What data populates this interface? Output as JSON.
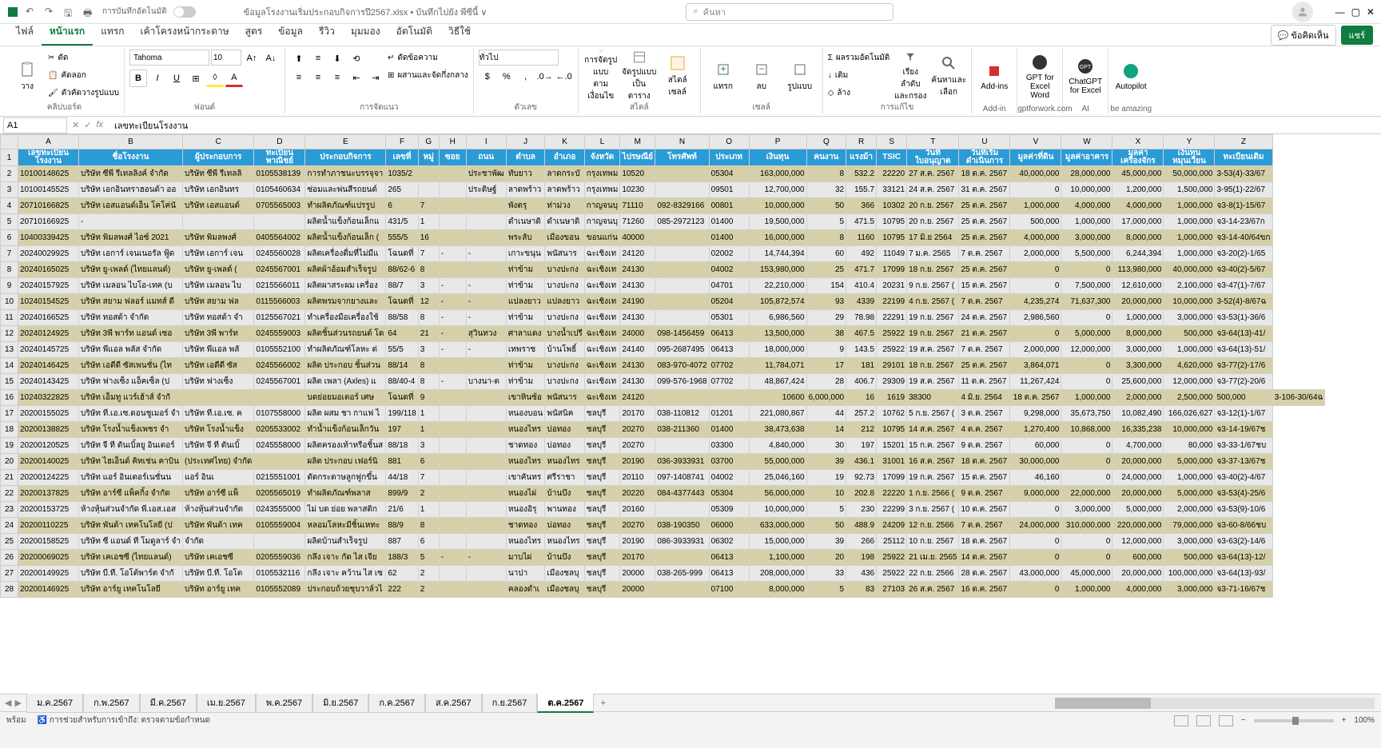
{
  "title": {
    "autosave_label": "การบันทึกอัตโนมัติ",
    "filename": "ข้อมูลโรงงานเริ่มประกอบกิจการปี2567.xlsx • บันทึกไปยัง พีซีนี้ ∨",
    "search_placeholder": "ค้นหา"
  },
  "tabs": [
    "ไฟล์",
    "หน้าแรก",
    "แทรก",
    "เค้าโครงหน้ากระดาษ",
    "สูตร",
    "ข้อมูล",
    "รีวิว",
    "มุมมอง",
    "อัตโนมัติ",
    "วิธีใช้"
  ],
  "active_tab": 1,
  "ribbon_right": {
    "comments": "ข้อคิดเห็น",
    "share": "แชร์"
  },
  "ribbon": {
    "clipboard": {
      "paste": "วาง",
      "cut": "ตัด",
      "copy": "คัดลอก",
      "fmtpaint": "ตัวคัดวางรูปแบบ",
      "group": "คลิปบอร์ด"
    },
    "font": {
      "name": "Tahoma",
      "size": "10",
      "group": "ฟอนต์"
    },
    "align": {
      "wrap": "ตัดข้อความ",
      "merge": "ผสานและจัดกึ่งกลาง",
      "group": "การจัดแนว"
    },
    "number": {
      "format": "ทั่วไป",
      "group": "ตัวเลข"
    },
    "styles": {
      "condfmt": "การจัดรูปแบบ\nตามเงื่อนไข",
      "table": "จัดรูปแบบ\nเป็นตาราง",
      "cellstyle": "สไตล์\nเซลล์",
      "group": "สไตล์"
    },
    "cells": {
      "insert": "แทรก",
      "delete": "ลบ",
      "format": "รูปแบบ",
      "group": "เซลล์"
    },
    "editing": {
      "sum": "ผลรวมอัตโนมัติ",
      "fill": "เติม",
      "clear": "ล้าง",
      "sort": "เรียงลำดับ\nและกรอง",
      "find": "ค้นหาและ\nเลือก",
      "group": "การแก้ไข"
    },
    "addins": {
      "addins": "Add-ins",
      "group": "Add-in"
    },
    "gpt": {
      "word": "GPT for\nExcel Word",
      "chat": "ChatGPT\nfor Excel",
      "auto": "Autopilot",
      "group1": "gptforwork.com",
      "group2": "AI",
      "group3": "be amazing"
    }
  },
  "formula": {
    "cell": "A1",
    "value": "เลขทะเบียนโรงงาน"
  },
  "cols": [
    "A",
    "B",
    "C",
    "D",
    "E",
    "F",
    "G",
    "H",
    "I",
    "J",
    "K",
    "L",
    "M",
    "N",
    "O",
    "P",
    "Q",
    "R",
    "S",
    "T",
    "U",
    "V",
    "W",
    "X",
    "Y",
    "Z"
  ],
  "headers": [
    "เลขทะเบียน\nโรงงาน",
    "ชื่อโรงงาน",
    "ผู้ประกอบการ",
    "ทะเบียน\nพาณิชย์",
    "ประกอบกิจการ",
    "เลขที่",
    "หมู่",
    "ซอย",
    "ถนน",
    "ตำบล",
    "อำเภอ",
    "จังหวัด",
    "ไปรษณีย์",
    "โทรศัพท์",
    "ประเภท",
    "เงินทุน",
    "คนงาน",
    "แรงม้า",
    "TSIC",
    "วันที่\nใบอนุญาต",
    "วันที่เริ่ม\nดำเนินการ",
    "มูลค่าที่ดิน",
    "มูลค่าอาคาร",
    "มูลค่า\nเครื่องจักร",
    "เงินทุน\nหมุนเวียน",
    "ทะเบียนเดิม"
  ],
  "rows": [
    [
      "10100148625",
      "บริษัท ซีพี รีเทลลิงค์ จำกัด",
      "บริษัท ซีพี รีเทลลิ",
      "0105538139",
      "การทำภาชนะบรรจุจา",
      "1035/2",
      "",
      "",
      "ประชาพัฒ",
      "ทับยาว",
      "ลาดกระบั",
      "กรุงเทพม",
      "10520",
      "",
      "05304",
      "163,000,000",
      "8",
      "532.2",
      "22220",
      "27 ส.ค. 2567",
      "18 ต.ค. 2567",
      "40,000,000",
      "28,000,000",
      "45,000,000",
      "50,000,000",
      "3-53(4)-33/67"
    ],
    [
      "10100145525",
      "บริษัท เอกอินทราฮอนด้า ออ",
      "บริษัท เอกอินทร",
      "0105460634",
      "ซ่อมและพ่นสีรถยนต์",
      "265",
      "",
      "",
      "ประดิษฐ์",
      "ลาดพร้าว",
      "ลาดพร้าว",
      "กรุงเทพม",
      "10230",
      "",
      "09501",
      "12,700,000",
      "32",
      "155.7",
      "33121",
      "24 ส.ค. 2567",
      "31 ต.ค. 2567",
      "0",
      "10,000,000",
      "1,200,000",
      "1,500,000",
      "3-95(1)-22/67"
    ],
    [
      "20710166825",
      "บริษัท เอสแอนด์เอ็น โคโค่นั",
      "บริษัท เอสแอนด์",
      "0705565003",
      "ทำผลิตภัณฑ์แปรรูป",
      "6",
      "7",
      "",
      "",
      "พังตรุ",
      "ท่าม่วง",
      "กาญจนบุ",
      "71110",
      "092-8329166",
      "00801",
      "10,000,000",
      "50",
      "366",
      "10302",
      "20 ก.ย. 2567",
      "25 ต.ค. 2567",
      "1,000,000",
      "4,000,000",
      "4,000,000",
      "1,000,000",
      "จ3-8(1)-15/67"
    ],
    [
      "20710166925",
      "-",
      "",
      "",
      "ผลิตน้ำแข็งก้อนเล็กแ",
      "431/5",
      "1",
      "",
      "",
      "ดำเนษาดิ",
      "ดำเนษาดิ",
      "กาญจนบุ",
      "71260",
      "085-2972123",
      "01400",
      "19,500,000",
      "5",
      "471.5",
      "10795",
      "20 ก.ย. 2567",
      "25 ต.ค. 2567",
      "500,000",
      "1,000,000",
      "17,000,000",
      "1,000,000",
      "จ3-14-23/67ก"
    ],
    [
      "10400339425",
      "บริษัท พิมลพงศ์ ไอซ์ 2021",
      "บริษัท พิมลพงศ์",
      "0405564002",
      "ผลิตน้ำแข็งก้อนเล็ก (",
      "555/5",
      "16",
      "",
      "",
      "พระลับ",
      "เมืองขอน",
      "ขอนแก่น",
      "40000",
      "",
      "01400",
      "16,000,000",
      "8",
      "1160",
      "10795",
      "17 มิ.ย 2564",
      "25 ต.ค. 2567",
      "4,000,000",
      "3,000,000",
      "8,000,000",
      "1,000,000",
      "จ3-14-40/64ขก"
    ],
    [
      "20240029925",
      "บริษัท เอการ์ เจนเนอรัล ฟู้ด",
      "บริษัท เอการ์ เจน",
      "0245560028",
      "ผลิตเครื่องดื่มที่ไม่มีแ",
      "โฉนดที่",
      "7",
      "-",
      "-",
      "เกาะขนุน",
      "พนัสนาร",
      "ฉะเชิงเท",
      "24120",
      "",
      "02002",
      "14,744,394",
      "60",
      "492",
      "11049",
      "7 ม.ค. 2565",
      "7 ต.ค. 2567",
      "2,000,000",
      "5,500,000",
      "6,244,394",
      "1,000,000",
      "จ3-20(2)-1/65"
    ],
    [
      "20240165025",
      "บริษัท ยู-เพลด์ (ไทยแลนด์)",
      "บริษัท ยู-เพลด์ (",
      "0245567001",
      "ผลิตผ้าอ้อมสำเร็จรูป",
      "88/62-6",
      "8",
      "",
      "",
      "ท่าข้าม",
      "บางปะกง",
      "ฉะเชิงเท",
      "24130",
      "",
      "04002",
      "153,980,000",
      "25",
      "471.7",
      "17099",
      "18 ก.ย. 2567",
      "25 ต.ค. 2567",
      "0",
      "0",
      "113,980,000",
      "40,000,000",
      "จ3-40(2)-5/67"
    ],
    [
      "20240157925",
      "บริษัท เมลอน ไบโอ-เทค (บ",
      "บริษัท เมลอน ไบ",
      "0215566011",
      "ผลิตผาสระผม เครื่อง",
      "88/7",
      "3",
      "-",
      "-",
      "ท่าข้าม",
      "บางปะกง",
      "ฉะเชิงเท",
      "24130",
      "",
      "04701",
      "22,210,000",
      "154",
      "410.4",
      "20231",
      "9 ก.ย. 2567 (",
      "15 ต.ค. 2567",
      "0",
      "7,500,000",
      "12,610,000",
      "2,100,000",
      "จ3-47(1)-7/67"
    ],
    [
      "10240154525",
      "บริษัท สยาม ฟลอร์ แมทส์ ดี",
      "บริษัท สยาม ฟล",
      "0115566003",
      "ผลิตพรมจากยางและ",
      "โฉนดที่",
      "12",
      "-",
      "-",
      "แปลงยาว",
      "แปลงยาว",
      "ฉะเชิงเท",
      "24190",
      "",
      "05204",
      "105,872,574",
      "93",
      "4339",
      "22199",
      "4 ก.ย. 2567 (",
      "7 ต.ค. 2567",
      "4,235,274",
      "71,637,300",
      "20,000,000",
      "10,000,000",
      "3-52(4)-8/67ฉ"
    ],
    [
      "20240166525",
      "บริษัท ทอสด้า จำกัด",
      "บริษัท ทอสด้า จำ",
      "0125567021",
      "ทำเครื่องมือเครื่องใช้",
      "88/58",
      "8",
      "-",
      "-",
      "ท่าข้าม",
      "บางปะกง",
      "ฉะเชิงเท",
      "24130",
      "",
      "05301",
      "6,986,560",
      "29",
      "78.98",
      "22291",
      "19 ก.ย. 2567",
      "24 ต.ค. 2567",
      "2,986,560",
      "0",
      "1,000,000",
      "3,000,000",
      "จ3-53(1)-36/6"
    ],
    [
      "20240124925",
      "บริษัท 3พี พาร์ท แอนด์ เซอ",
      "บริษัท 3พี พาร์ท",
      "0245559003",
      "ผลิตชิ้นส่วนรถยนต์ โด",
      "64",
      "21",
      "-",
      "สุวินทวง",
      "ศาลาแดง",
      "บางน้ำเปรี",
      "ฉะเชิงเท",
      "24000",
      "098-1456459",
      "06413",
      "13,500,000",
      "38",
      "467.5",
      "25922",
      "19 ก.ย. 2567",
      "21 ต.ค. 2567",
      "0",
      "5,000,000",
      "8,000,000",
      "500,000",
      "จ3-64(13)-41/"
    ],
    [
      "20240145725",
      "บริษัท พีแอล พลัส จำกัด",
      "บริษัท พีแอล พลั",
      "0105552100",
      "ทำผลิตภัณฑ์โลหะ ต่",
      "55/5",
      "3",
      "-",
      "-",
      "เทพราช",
      "บ้านโพธิ์",
      "ฉะเชิงเท",
      "24140",
      "095-2687495",
      "06413",
      "18,000,000",
      "9",
      "143.5",
      "25922",
      "19 ส.ค. 2567",
      "7 ต.ค. 2567",
      "2,000,000",
      "12,000,000",
      "3,000,000",
      "1,000,000",
      "จ3-64(13)-51/"
    ],
    [
      "20240146425",
      "บริษัท เอดีดี ซัสเพนชั่น (ไท",
      "บริษัท เอดีดี ซัส",
      "0245566002",
      "ผลิต ประกอบ ชิ้นส่วน",
      "88/14",
      "8",
      "",
      "",
      "ท่าข้าม",
      "บางปะกง",
      "ฉะเชิงเท",
      "24130",
      "083-970-4072",
      "07702",
      "11,784,071",
      "17",
      "181",
      "29101",
      "18 ก.ย. 2567",
      "25 ต.ค. 2567",
      "3,864,071",
      "0",
      "3,300,000",
      "4,620,000",
      "จ3-77(2)-17/6"
    ],
    [
      "20240143425",
      "บริษัท ฟางเซ็ง แอ็คเซ็ล (ป",
      "บริษัท ฟางเซ็ง",
      "0245567001",
      "ผลิต เพลา (Axles) แ",
      "88/40-4",
      "8",
      "-",
      "บางนา-ต",
      "ท่าข้าม",
      "บางปะกง",
      "ฉะเชิงเท",
      "24130",
      "099-576-1968",
      "07702",
      "48,867,424",
      "28",
      "406.7",
      "29309",
      "19 ส.ค. 2567",
      "11 ต.ค. 2567",
      "11,267,424",
      "0",
      "25,600,000",
      "12,000,000",
      "จ3-77(2)-20/6"
    ],
    [
      "10240322825",
      "บริษัท เอ็มทู แวร์เฮ้าส์ จำกั",
      "",
      "",
      "บดย่อยมอเตอร์ เศษ",
      "โฉนดที่",
      "9",
      "",
      "",
      "เขาหินซ้อ",
      "พนัสนาร",
      "ฉะเชิงเท",
      "24120",
      "",
      "",
      "10600",
      "6,000,000",
      "16",
      "1619",
      "38300",
      "4 มิ.ย. 2564",
      "18 ต.ค. 2567",
      "1,000,000",
      "2,000,000",
      "2,500,000",
      "500,000",
      "3-106-30/64ฉ"
    ],
    [
      "20200155025",
      "บริษัท ที.เอ.เซ.ดอนชูเมอร์ จำ",
      "บริษัท ที.เอ.เซ. ค",
      "0107558000",
      "ผลิต ผสม ชา กาแฟ ไ",
      "199/118",
      "1",
      "",
      "",
      "หนองบอน",
      "พนัสนิค",
      "ชลบุรี",
      "20170",
      "038-110812",
      "01201",
      "221,080,867",
      "44",
      "257.2",
      "10762",
      "5 ก.ย. 2567 (",
      "3 ต.ค. 2567",
      "9,298,000",
      "35,673,750",
      "10,082,490",
      "166,026,627",
      "จ3-12(1)-1/67"
    ],
    [
      "20200138825",
      "บริษัท โรงน้ำแข็งเพชร จำ",
      "บริษัท โรงน้ำแข็ง",
      "0205533002",
      "ทำน้ำแข็งก้อนเล็กวัน",
      "197",
      "1",
      "",
      "",
      "หนองไทร",
      "บ่อทอง",
      "ชลบุรี",
      "20270",
      "038-211360",
      "01400",
      "38,473,638",
      "14",
      "212",
      "10795",
      "14 ส.ค. 2567",
      "4 ต.ค. 2567",
      "1,270,400",
      "10,868,000",
      "16,335,238",
      "10,000,000",
      "จ3-14-19/67ช"
    ],
    [
      "20200120525",
      "บริษัท จี ที ตันเบิ้ลยู อินเตอร์",
      "บริษัท จี ที ตันเบิ้",
      "0245558000",
      "ผลิตครองเท้าหรือชิ้นส",
      "88/18",
      "3",
      "",
      "",
      "ชาดทอง",
      "บ่อทอง",
      "ชลบุรี",
      "20270",
      "",
      "03300",
      "4,840,000",
      "30",
      "197",
      "15201",
      "15 ก.ค. 2567",
      "9 ต.ค. 2567",
      "60,000",
      "0",
      "4,700,000",
      "80,000",
      "จ3-33-1/67ชบ"
    ],
    [
      "20200140025",
      "บริษัท ไฮเอ็นด์ คิทเช่น คาบิน",
      "(ประเทศไทย) จำกัด",
      "",
      "ผลิต ประกอบ เฟอร์นิ",
      "881",
      "6",
      "",
      "",
      "หนองไทร",
      "หนองไทร",
      "ชลบุรี",
      "20190",
      "036-3933931",
      "03700",
      "55,000,000",
      "39",
      "436.1",
      "31001",
      "16 ส.ค. 2567",
      "18 ต.ค. 2567",
      "30,000,000",
      "0",
      "20,000,000",
      "5,000,000",
      "จ3-37-13/67ช"
    ],
    [
      "20200124225",
      "บริษัท แอร์ อินเตอร์เนชั่นน",
      "แอร์ อินเ",
      "0215551001",
      "ตัดกระดาษลูกฟูกขึ้น",
      "44/18",
      "7",
      "",
      "",
      "เขาคันทร",
      "ศรีราชา",
      "ชลบุรี",
      "20110",
      "097-1408741",
      "04002",
      "25,046,160",
      "19",
      "92.73",
      "17099",
      "19 ก.ค. 2567",
      "15 ต.ค. 2567",
      "46,160",
      "0",
      "24,000,000",
      "1,000,000",
      "จ3-40(2)-4/67"
    ],
    [
      "20200137825",
      "บริษัท อาร์ซี แพ็คกิ้ง จำกัด",
      "บริษัท อาร์ซี แพ็",
      "0205565019",
      "ทำผลิตภัณฑ์พลาส",
      "899/9",
      "2",
      "",
      "",
      "หนองไผ่",
      "บ้านบึง",
      "ชลบุรี",
      "20220",
      "084-4377443",
      "05304",
      "56,000,000",
      "10",
      "202.8",
      "22220",
      "1 ก.ย. 2566 (",
      "9 ต.ค. 2567",
      "9,000,000",
      "22,000,000",
      "20,000,000",
      "5,000,000",
      "จ3-53(4)-25/6"
    ],
    [
      "20200153725",
      "ห้างหุ้นส่วนจำกัด พี.เอส.เอส",
      "ห้างหุ้นส่วนจำกัด",
      "0243555000",
      "ไม่ บด ย่อย พลาสติก",
      "21/6",
      "1",
      "",
      "",
      "หนองอิรุ",
      "พานทอง",
      "ชลบุรี",
      "20160",
      "",
      "05309",
      "10,000,000",
      "5",
      "230",
      "22299",
      "3 ก.ย. 2567 (",
      "10 ต.ค. 2567",
      "0",
      "3,000,000",
      "5,000,000",
      "2,000,000",
      "จ3-53(9)-10/6"
    ],
    [
      "20200110225",
      "บริษัท พันด้า เทคโนโลยี (ป",
      "บริษัท พันด้า เทค",
      "0105559004",
      "หลอมโลหะมีชิ้นเหทะ",
      "88/9",
      "8",
      "",
      "",
      "ชาดทอง",
      "บ่อทอง",
      "ชลบุรี",
      "20270",
      "038-190350",
      "06000",
      "633,000,000",
      "50",
      "488.9",
      "24209",
      "12 ก.ย. 2566",
      "7 ต.ค. 2567",
      "24,000,000",
      "310,000,000",
      "220,000,000",
      "79,000,000",
      "จ3-60-8/66ชบ"
    ],
    [
      "20200158525",
      "บริษัท ซี แอนด์ ที โมดูลาร์ จำ",
      "จำกัด",
      "",
      "ผลิตบ้านสำเร็จรูป",
      "887",
      "6",
      "",
      "",
      "หนองไทร",
      "หนองไทร",
      "ชลบุรี",
      "20190",
      "086-3933931",
      "06302",
      "15,000,000",
      "39",
      "266",
      "25112",
      "10 ก.ย. 2567",
      "18 ต.ค. 2567",
      "0",
      "0",
      "12,000,000",
      "3,000,000",
      "จ3-63(2)-14/6"
    ],
    [
      "20200069025",
      "บริษัท เคเอชซี (ไทยแลนด์)",
      "บริษัท เคเอชซี",
      "0205559036",
      "กลึง เจาะ กัด ไส เจีย",
      "188/3",
      "5",
      "-",
      "-",
      "มาบไผ่",
      "บ้านบึง",
      "ชลบุรี",
      "20170",
      "",
      "06413",
      "1,100,000",
      "20",
      "198",
      "25922",
      "21 เม.ย. 2565",
      "14 ต.ค. 2567",
      "0",
      "0",
      "600,000",
      "500,000",
      "จ3-64(13)-12/"
    ],
    [
      "20200149925",
      "บริษัท บี.ที. โอโต้พาร์ต จำกั",
      "บริษัท บี.ที. โอโต",
      "0105532116",
      "กลึง เจาะ คว้าน ไส เซ",
      "62",
      "2",
      "",
      "",
      "นาปา",
      "เมืองชลบุ",
      "ชลบุรี",
      "20000",
      "038-265-999",
      "06413",
      "208,000,000",
      "33",
      "436",
      "25922",
      "22 ก.ย. 2566",
      "28 ต.ค. 2567",
      "43,000,000",
      "45,000,000",
      "20,000,000",
      "100,000,000",
      "จ3-64(13)-93/"
    ],
    [
      "20200146925",
      "บริษัท อาร์ยู เทคโนโลยี",
      "บริษัท อาร์ยู เทค",
      "0105552089",
      "ประกอบถ้วยชุบวาล์วไ",
      "222",
      "2",
      "",
      "",
      "คลองดำเ",
      "เมืองชลบุ",
      "ชลบุรี",
      "20000",
      "",
      "07100",
      "8,000,000",
      "5",
      "83",
      "27103",
      "26 ส.ค. 2567",
      "16 ต.ค. 2567",
      "0",
      "1,000,000",
      "4,000,000",
      "3,000,000",
      "จ3-71-16/67ช"
    ]
  ],
  "sheets": [
    "ม.ค.2567",
    "ก.พ.2567",
    "มี.ค.2567",
    "เม.ย.2567",
    "พ.ค.2567",
    "มิ.ย.2567",
    "ก.ค.2567",
    "ส.ค.2567",
    "ก.ย.2567",
    "ต.ค.2567"
  ],
  "active_sheet": 9,
  "status": {
    "ready": "พร้อม",
    "access": "การช่วยสำหรับการเข้าถึง: ตรวจตามข้อกำหนด",
    "zoom": "100%"
  }
}
